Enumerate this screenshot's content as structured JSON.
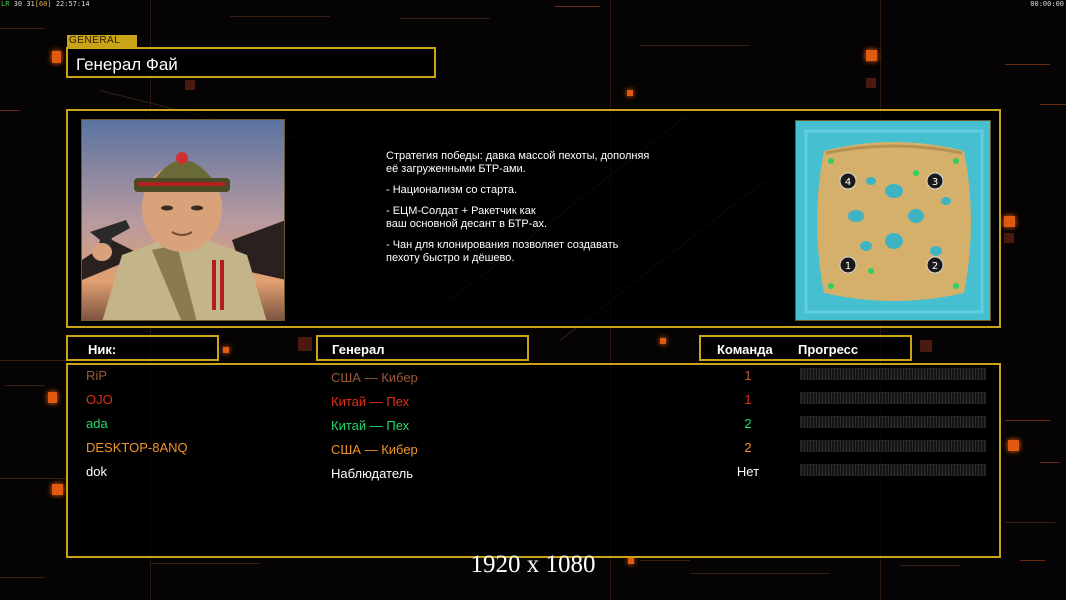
{
  "topbar": {
    "left_tag": "LR",
    "left_a": "30",
    "left_b": "31",
    "left_c": "[60]",
    "left_time": "22:57:14",
    "right_time": "00:00:00"
  },
  "general": {
    "tag": "GENERAL",
    "name": "Генерал Фай",
    "description": [
      "Стратегия победы: давка массой пехоты, дополняя её загруженными БТР-ами.",
      "- Национализм со старта.",
      "- ЕЦМ-Солдат + Ракетчик как ваш основной десант в БТР-ах.",
      "- Чан для клонирования позволяет создавать пехоту быстро и дёшево."
    ],
    "description_lines": [
      [
        "Стратегия победы: давка массой пехоты, дополняя",
        " её загруженными БТР-ами."
      ],
      [
        "- Национализм со старта."
      ],
      [
        "- ЕЦМ-Солдат + Ракетчик как",
        "ваш основной десант в БТР-ах."
      ],
      [
        "- Чан для клонирования позволяет создавать",
        " пехоту быстро и дёшево."
      ]
    ]
  },
  "minimap": {
    "start_positions": [
      "1",
      "2",
      "3",
      "4"
    ]
  },
  "headers": {
    "nick": "Ник:",
    "general": "Генерал",
    "team": "Команда",
    "progress": "Прогресс"
  },
  "players": [
    {
      "nick": "RiP",
      "general": "США — Кибер",
      "team": "1",
      "color": "#9c5a3a",
      "team_color": "#c25a2a"
    },
    {
      "nick": "OJO",
      "general": "Китай — Пех",
      "team": "1",
      "color": "#e0301c",
      "team_color": "#e0301c"
    },
    {
      "nick": "ada",
      "general": "Китай — Пех",
      "team": "2",
      "color": "#27d86a",
      "team_color": "#27d86a"
    },
    {
      "nick": "DESKTOP-8ANQ",
      "general": "США — Кибер",
      "team": "2",
      "color": "#f0952a",
      "team_color": "#f0952a"
    },
    {
      "nick": "dok",
      "general": "Наблюдатель",
      "team": "Нет",
      "color": "#ffffff",
      "team_color": "#ffffff"
    }
  ],
  "resolution": "1920 x 1080",
  "colors": {
    "gold": "#c9a418",
    "accent_orange": "#e05a10"
  }
}
